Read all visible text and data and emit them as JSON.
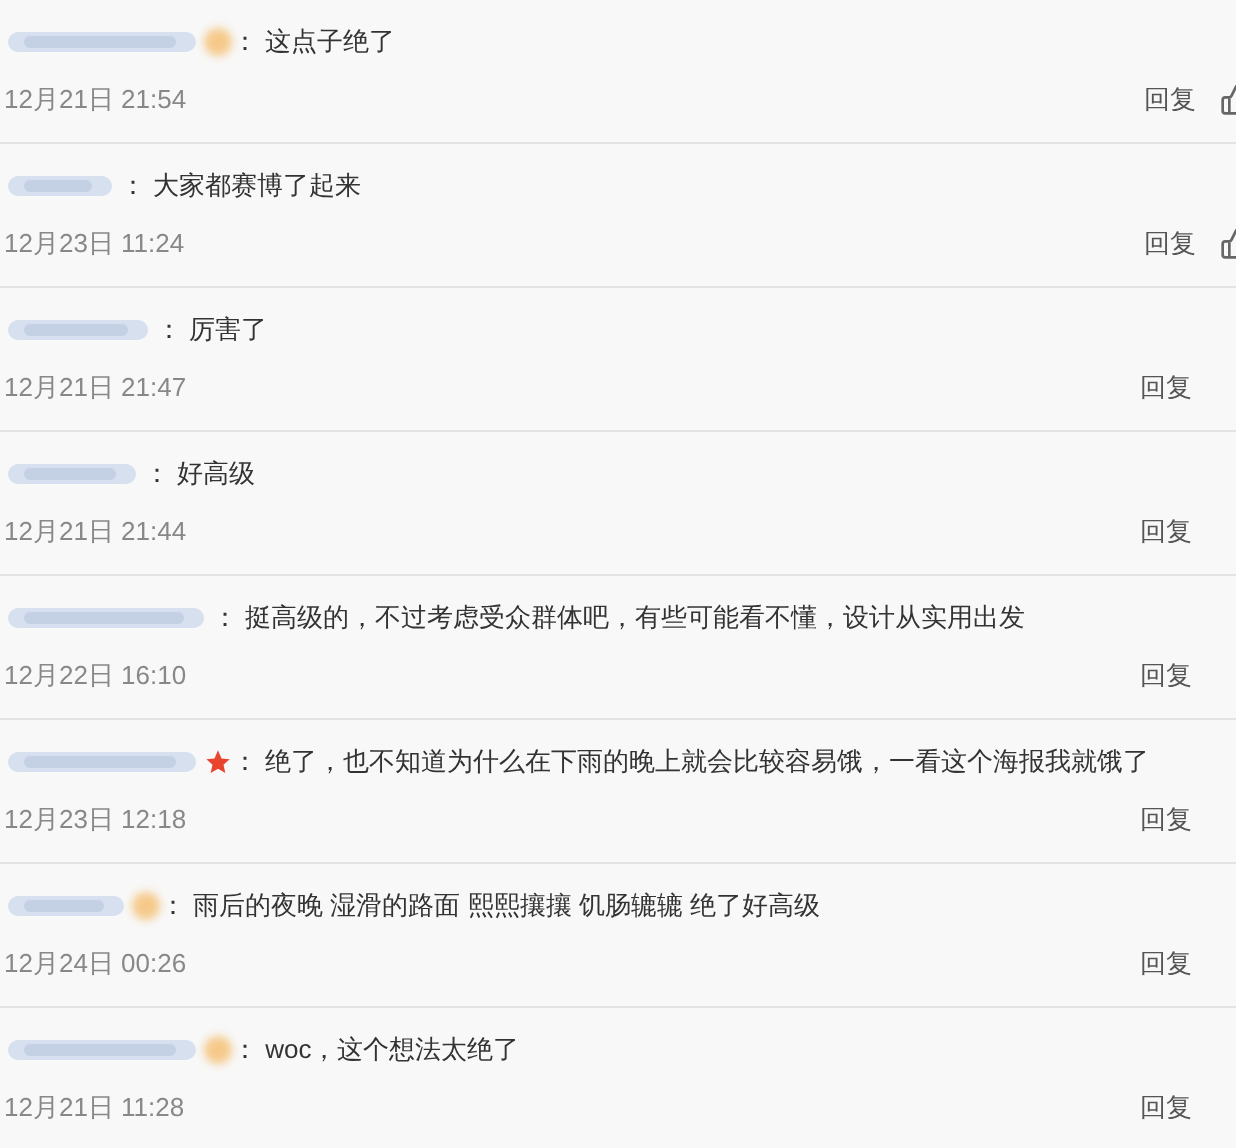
{
  "comments": [
    {
      "separator": "：",
      "text": "这点子绝了",
      "time": "12月21日 21:54",
      "reply": "回复",
      "like_shown": true,
      "kind": "blob"
    },
    {
      "separator": "：",
      "text": "大家都赛博了起来",
      "time": "12月23日 11:24",
      "reply": "回复",
      "like_shown": true,
      "kind": "plain"
    },
    {
      "separator": "：",
      "text": "厉害了",
      "time": "12月21日 21:47",
      "reply": "回复",
      "like_shown": false,
      "kind": "plain"
    },
    {
      "separator": "：",
      "text": "好高级",
      "time": "12月21日 21:44",
      "reply": "回复",
      "like_shown": false,
      "kind": "plain"
    },
    {
      "separator": "：",
      "text": "挺高级的，不过考虑受众群体吧，有些可能看不懂，设计从实用出发",
      "time": "12月22日 16:10",
      "reply": "回复",
      "like_shown": false,
      "kind": "plain"
    },
    {
      "separator": "：",
      "text": "绝了，也不知道为什么在下雨的晚上就会比较容易饿，一看这个海报我就饿了",
      "time": "12月23日 12:18",
      "reply": "回复",
      "like_shown": false,
      "kind": "star"
    },
    {
      "separator": "：",
      "text": "雨后的夜晚 湿滑的路面 熙熙攘攘 饥肠辘辘 绝了好高级",
      "time": "12月24日 00:26",
      "reply": "回复",
      "like_shown": false,
      "kind": "blob"
    },
    {
      "separator": "：",
      "text": "woc，这个想法太绝了",
      "time": "12月21日 11:28",
      "reply": "回复",
      "like_shown": false,
      "kind": "blob"
    }
  ]
}
